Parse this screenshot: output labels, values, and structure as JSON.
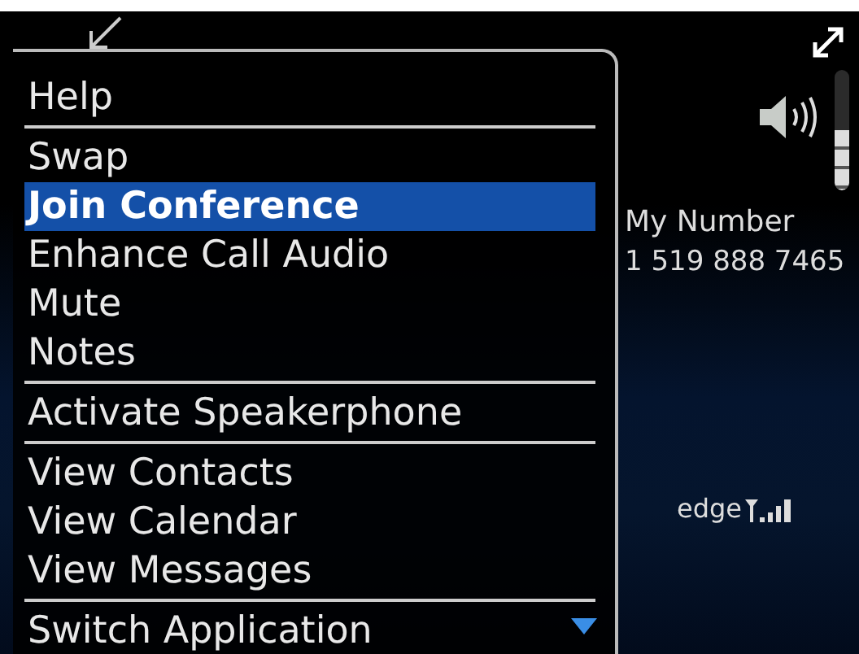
{
  "menu": {
    "groups": [
      [
        {
          "label": "Help",
          "selected": false
        }
      ],
      [
        {
          "label": "Swap",
          "selected": false
        },
        {
          "label": "Join Conference",
          "selected": true
        },
        {
          "label": "Enhance Call Audio",
          "selected": false
        },
        {
          "label": "Mute",
          "selected": false
        },
        {
          "label": "Notes",
          "selected": false
        }
      ],
      [
        {
          "label": "Activate Speakerphone",
          "selected": false
        }
      ],
      [
        {
          "label": "View Contacts",
          "selected": false
        },
        {
          "label": "View Calendar",
          "selected": false
        },
        {
          "label": "View Messages",
          "selected": false
        }
      ],
      [
        {
          "label": "Switch Application",
          "selected": false
        }
      ]
    ]
  },
  "volume": {
    "level": 0.5
  },
  "my_number": {
    "label": "My Number",
    "value": "1 519 888 7465"
  },
  "status": {
    "network": "edge"
  }
}
